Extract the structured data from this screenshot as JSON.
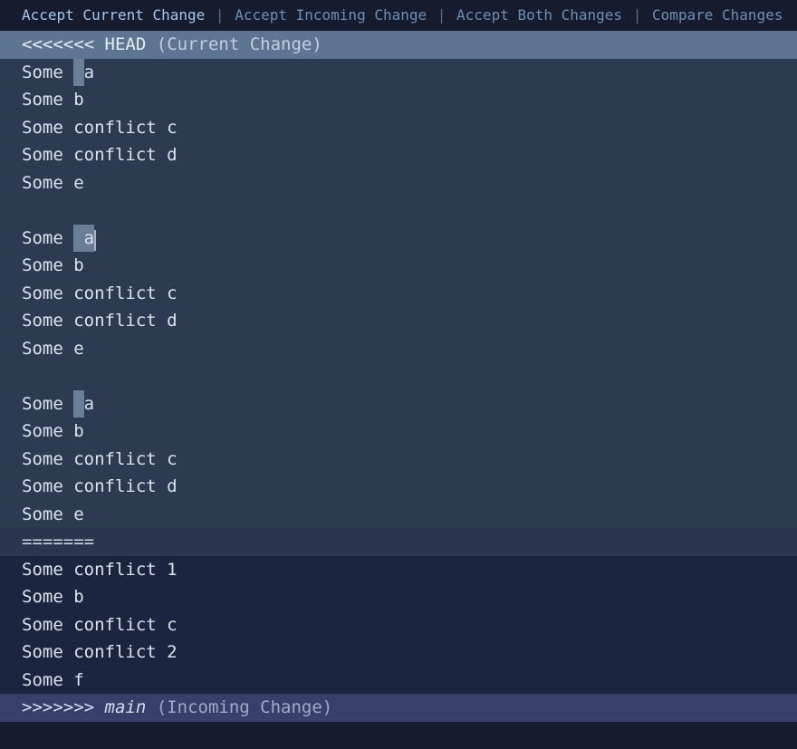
{
  "codelens": {
    "accept_current": "Accept Current Change",
    "accept_incoming": "Accept Incoming Change",
    "accept_both": "Accept Both Changes",
    "compare": "Compare Changes",
    "separator": " | "
  },
  "conflict": {
    "head_marker": "<<<<<<<",
    "head_ref": "HEAD",
    "head_annotation": "(Current Change)",
    "separator": "=======",
    "tail_marker": ">>>>>>>",
    "tail_ref": "main",
    "tail_annotation": "(Incoming Change)"
  },
  "current_lines": [
    "Some  a",
    "Some b",
    "Some conflict c",
    "Some conflict d",
    "Some e",
    "",
    "Some  a",
    "Some b",
    "Some conflict c",
    "Some conflict d",
    "Some e",
    "",
    "Some  a",
    "Some b",
    "Some conflict c",
    "Some conflict d",
    "Some e"
  ],
  "incoming_lines": [
    "Some conflict 1",
    "Some b",
    "Some conflict c",
    "Some conflict 2",
    "Some f"
  ],
  "cursor": {
    "highlight_char": "a",
    "highlight_space": " "
  }
}
